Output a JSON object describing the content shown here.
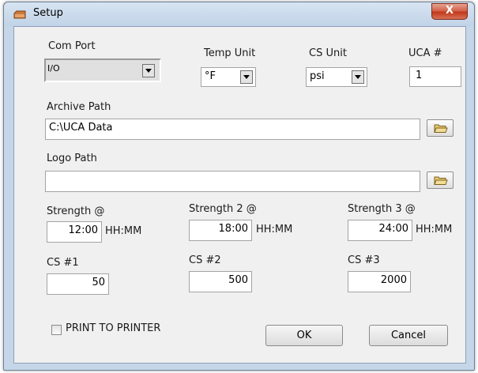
{
  "window": {
    "title": "Setup",
    "close_glyph": "X"
  },
  "com_port": {
    "label": "Com Port",
    "value": "I/O"
  },
  "temp_unit": {
    "label": "Temp Unit",
    "value": "°F"
  },
  "cs_unit": {
    "label": "CS Unit",
    "value": "psi"
  },
  "uca": {
    "label": "UCA #",
    "value": "1"
  },
  "archive_path": {
    "label": "Archive Path",
    "value": "C:\\UCA Data"
  },
  "logo_path": {
    "label": "Logo Path",
    "value": ""
  },
  "strength1": {
    "label": "Strength @",
    "value": "12:00",
    "unit": "HH:MM"
  },
  "strength2": {
    "label": "Strength 2 @",
    "value": "18:00",
    "unit": "HH:MM"
  },
  "strength3": {
    "label": "Strength 3 @",
    "value": "24:00",
    "unit": "HH:MM"
  },
  "cs1": {
    "label": "CS #1",
    "value": "50"
  },
  "cs2": {
    "label": "CS #2",
    "value": "500"
  },
  "cs3": {
    "label": "CS #3",
    "value": "2000"
  },
  "print_to_printer": {
    "label": "PRINT TO PRINTER",
    "checked": false
  },
  "buttons": {
    "ok": "OK",
    "cancel": "Cancel"
  },
  "icons": {
    "window": "window-icon",
    "close": "close-icon",
    "browse": "folder-icon"
  }
}
